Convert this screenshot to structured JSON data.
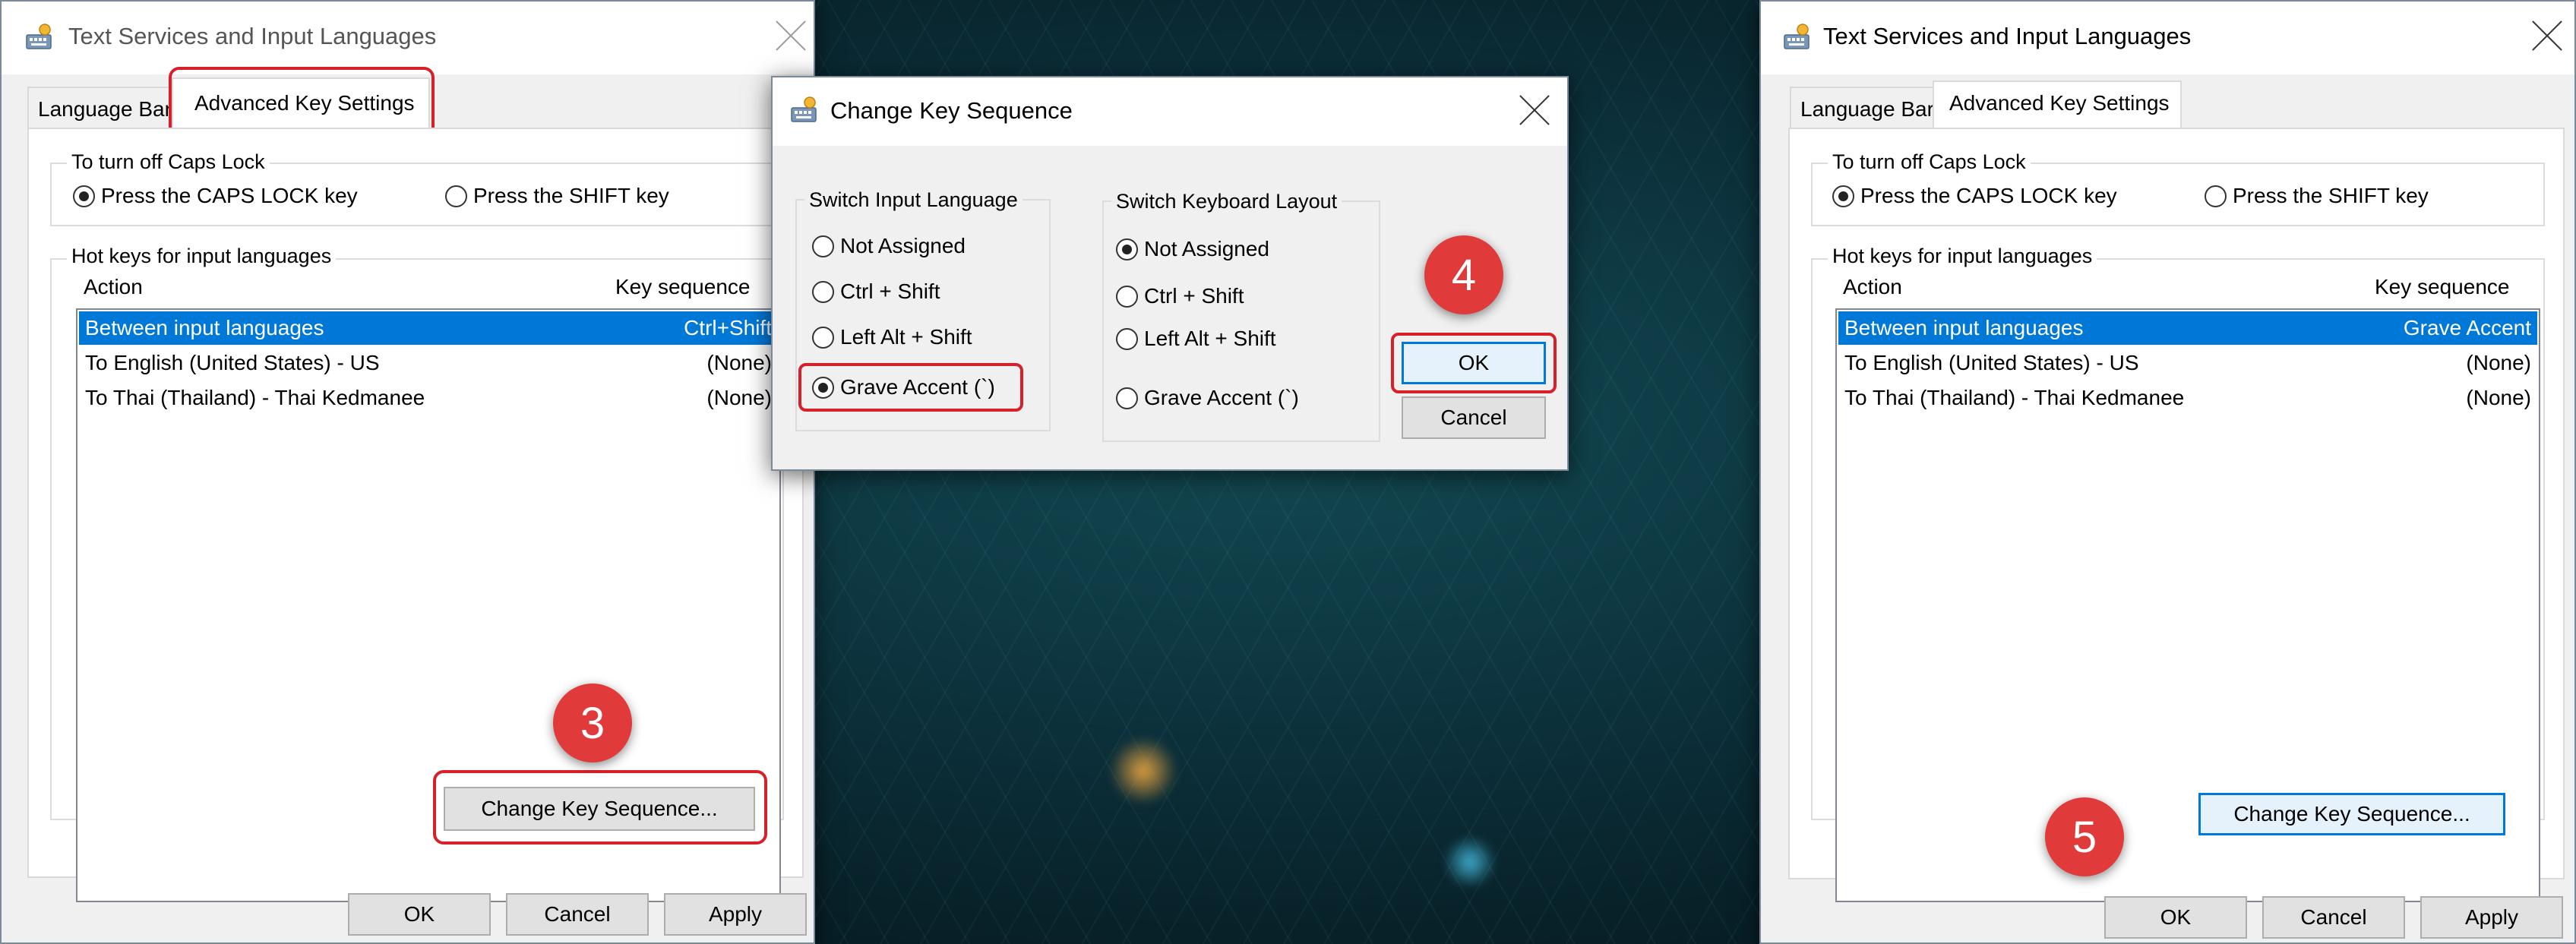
{
  "left_dialog": {
    "title": "Text Services and Input Languages",
    "tabs": [
      "Language Bar",
      "Advanced Key Settings"
    ],
    "caps_group": {
      "legend": "To turn off Caps Lock",
      "option1": "Press the CAPS LOCK key",
      "option2": "Press the SHIFT key"
    },
    "hotkeys_group": {
      "legend": "Hot keys for input languages",
      "col_action": "Action",
      "col_key": "Key sequence"
    },
    "rows": [
      {
        "action": "Between input languages",
        "key": "Ctrl+Shift"
      },
      {
        "action": "To English (United States) - US",
        "key": "(None)"
      },
      {
        "action": "To Thai (Thailand) - Thai Kedmanee",
        "key": "(None)"
      }
    ],
    "change_button": "Change Key Sequence...",
    "buttons": {
      "ok": "OK",
      "cancel": "Cancel",
      "apply": "Apply"
    }
  },
  "middle_dialog": {
    "title": "Change Key Sequence",
    "input_group": {
      "legend": "Switch Input Language",
      "options": [
        "Not Assigned",
        "Ctrl + Shift",
        "Left Alt + Shift",
        "Grave Accent (`)"
      ]
    },
    "layout_group": {
      "legend": "Switch Keyboard Layout",
      "options": [
        "Not Assigned",
        "Ctrl + Shift",
        "Left Alt + Shift",
        "Grave Accent (`)"
      ]
    },
    "buttons": {
      "ok": "OK",
      "cancel": "Cancel"
    }
  },
  "right_dialog": {
    "title": "Text Services and Input Languages",
    "tabs": [
      "Language Bar",
      "Advanced Key Settings"
    ],
    "caps_group": {
      "legend": "To turn off Caps Lock",
      "option1": "Press the CAPS LOCK key",
      "option2": "Press the SHIFT key"
    },
    "hotkeys_group": {
      "legend": "Hot keys for input languages",
      "col_action": "Action",
      "col_key": "Key sequence"
    },
    "rows": [
      {
        "action": "Between input languages",
        "key": "Grave Accent"
      },
      {
        "action": "To English (United States) - US",
        "key": "(None)"
      },
      {
        "action": "To Thai (Thailand) - Thai Kedmanee",
        "key": "(None)"
      }
    ],
    "change_button": "Change Key Sequence...",
    "buttons": {
      "ok": "OK",
      "cancel": "Cancel",
      "apply": "Apply"
    }
  },
  "steps": {
    "three": "3",
    "four": "4",
    "five": "5"
  },
  "colors": {
    "selection": "#0078d7",
    "callout": "#d8202a",
    "step_badge": "#e03a3a"
  },
  "icons": {
    "title": "keyboard-settings-icon",
    "close": "close-icon"
  }
}
